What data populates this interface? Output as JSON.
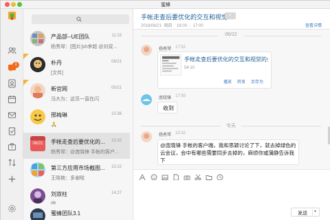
{
  "window": {
    "title": "蜜蜂"
  },
  "sidebar": {
    "icons": [
      {
        "name": "contacts-icon"
      },
      {
        "name": "chat-icon",
        "badge": "1"
      },
      {
        "name": "profile-card-icon"
      },
      {
        "name": "calendar-icon"
      },
      {
        "name": "mail-icon"
      },
      {
        "name": "task-icon"
      },
      {
        "name": "briefcase-icon"
      },
      {
        "name": "transfer-icon"
      },
      {
        "name": "add-icon"
      },
      {
        "name": "settings-icon"
      }
    ],
    "badge_color": "#f26b1d"
  },
  "conversation_list": {
    "search_icon": "search-icon",
    "items": [
      {
        "name": "产品部--UE团队",
        "time": "11:15",
        "preview": "杨秀琴：[图片]sh李超  @刘双...",
        "flagged": false
      },
      {
        "name": "朴丹",
        "time": "06/21",
        "preview": "[文件]",
        "flagged": true
      },
      {
        "name": "新官网",
        "time": "05/21",
        "preview": "冯大为：这页一直在闪",
        "flagged": true
      },
      {
        "name": "邢梅琳",
        "time": "15:36",
        "preview": "🙏",
        "flagged": false
      },
      {
        "name": "手帐走查后要优化的...",
        "time": "15:32",
        "preview": "杨秀琴：@庞晓锋  手帐的客户...",
        "flagged": false,
        "selected": true,
        "avatar_text": "06/21"
      },
      {
        "name": "第三方应用市场截图...",
        "time": "15:22",
        "preview": "王晓艳：多谢啦",
        "flagged": false
      },
      {
        "name": "刘双柱",
        "time": "14:27",
        "preview": "ok",
        "flagged": false
      },
      {
        "name": "蜜蜂团队3.1",
        "time": "",
        "preview": "",
        "flagged": false
      }
    ]
  },
  "chat": {
    "title": "手帐走查后要优化的交互和视觉",
    "meta": "2018/06/21  周四    16:00  -  17:00",
    "detail_link": "查看详情",
    "date_divider_1": "06/22",
    "date_divider_2": "今天",
    "messages": [
      {
        "sender": "杨秀琴",
        "time": "17:52"
      },
      {
        "sender": "庞晓锋",
        "time": "17:55",
        "text": "收到"
      },
      {
        "sender": "杨秀琴",
        "time": "15:32",
        "text_line1": "@庞晓锋  手帐的客户端，我和思颖讨论了下，就去掉绿色的",
        "text_line2": "云会议，会中有哪些需要同步去掉的，麻烦你或蒲静告诉我",
        "text_line3": "下"
      }
    ],
    "card": {
      "title": "手帐走查后要优化的交互和视觉的会...",
      "size": "54:10",
      "actions": [
        "播放",
        "转发",
        "另存为"
      ]
    },
    "toolbar_icons": [
      "font-icon",
      "emoji-icon",
      "image-icon",
      "file-icon",
      "screenshot-icon",
      "scissors-icon",
      "folder-icon",
      "clock-icon"
    ],
    "send_label": "发送",
    "accent": "#1f5e95",
    "link_color": "#3b7bc7"
  }
}
